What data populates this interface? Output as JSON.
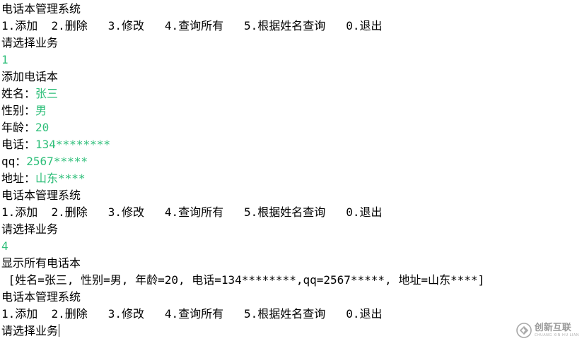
{
  "console": {
    "lines": [
      {
        "segments": [
          {
            "text": "电话本管理系统",
            "type": "output"
          }
        ]
      },
      {
        "segments": [
          {
            "text": "1.添加  2.删除   3.修改   4.查询所有   5.根据姓名查询   0.退出",
            "type": "output"
          }
        ]
      },
      {
        "segments": [
          {
            "text": "请选择业务",
            "type": "output"
          }
        ]
      },
      {
        "segments": [
          {
            "text": "1",
            "type": "input"
          }
        ]
      },
      {
        "segments": [
          {
            "text": "添加电话本",
            "type": "output"
          }
        ]
      },
      {
        "segments": [
          {
            "text": "姓名：",
            "type": "output"
          },
          {
            "text": "张三",
            "type": "input"
          }
        ]
      },
      {
        "segments": [
          {
            "text": "性别：",
            "type": "output"
          },
          {
            "text": "男",
            "type": "input"
          }
        ]
      },
      {
        "segments": [
          {
            "text": "年龄：",
            "type": "output"
          },
          {
            "text": "20",
            "type": "input"
          }
        ]
      },
      {
        "segments": [
          {
            "text": "电话：",
            "type": "output"
          },
          {
            "text": "134********",
            "type": "input"
          }
        ]
      },
      {
        "segments": [
          {
            "text": "qq：",
            "type": "output"
          },
          {
            "text": "2567*****",
            "type": "input"
          }
        ]
      },
      {
        "segments": [
          {
            "text": "地址：",
            "type": "output"
          },
          {
            "text": "山东****",
            "type": "input"
          }
        ]
      },
      {
        "segments": [
          {
            "text": "电话本管理系统",
            "type": "output"
          }
        ]
      },
      {
        "segments": [
          {
            "text": "1.添加  2.删除   3.修改   4.查询所有   5.根据姓名查询   0.退出",
            "type": "output"
          }
        ]
      },
      {
        "segments": [
          {
            "text": "请选择业务",
            "type": "output"
          }
        ]
      },
      {
        "segments": [
          {
            "text": "4",
            "type": "input"
          }
        ]
      },
      {
        "segments": [
          {
            "text": "显示所有电话本",
            "type": "output"
          }
        ]
      },
      {
        "segments": [
          {
            "text": " [姓名=张三, 性别=男, 年龄=20, 电话=134********,qq=2567*****, 地址=山东****]",
            "type": "output"
          }
        ]
      },
      {
        "segments": [
          {
            "text": "电话本管理系统",
            "type": "output"
          }
        ]
      },
      {
        "segments": [
          {
            "text": "1.添加  2.删除   3.修改   4.查询所有   5.根据姓名查询   0.退出",
            "type": "output"
          }
        ]
      },
      {
        "segments": [
          {
            "text": "请选择业务",
            "type": "output"
          }
        ],
        "cursor": true
      }
    ],
    "colors": {
      "output": "#000000",
      "input": "#2fbf7a",
      "background": "#ffffff"
    }
  },
  "watermark": {
    "cn_text": "创新互联",
    "en_text": "CHUANG XIN HU LIAN",
    "icon": "chuangxin-logo-icon"
  }
}
